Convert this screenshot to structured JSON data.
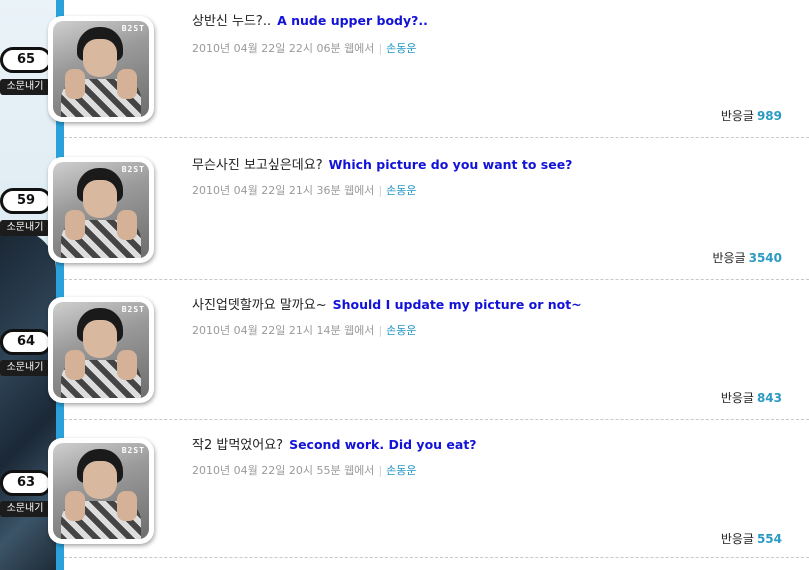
{
  "gossip_label": "소문내기",
  "reply_label": "반응글",
  "posts": [
    {
      "count": "65",
      "title": "상반신 누드?..",
      "translation": "A nude upper body?..",
      "meta": "2010년 04월 22일 22시 06분 웹에서",
      "author": "손동운",
      "replies": "989",
      "avatar_logo": "B2ST"
    },
    {
      "count": "59",
      "title": "무슨사진 보고싶은데요?",
      "translation": "Which picture do you want to see?",
      "meta": "2010년 04월 22일 21시 36분 웹에서",
      "author": "손동운",
      "replies": "3540",
      "avatar_logo": "B2ST"
    },
    {
      "count": "64",
      "title": "사진업뎃할까요 말까요~",
      "translation": "Should I update my picture or not~",
      "meta": "2010년 04월 22일 21시 14분 웹에서",
      "author": "손동운",
      "replies": "843",
      "avatar_logo": "B2ST"
    },
    {
      "count": "63",
      "title": "작2 밥먹었어요?",
      "translation": "Second work. Did you eat?",
      "meta": "2010년 04월 22일 20시 55분 웹에서",
      "author": "손동운",
      "replies": "554",
      "avatar_logo": "B2ST"
    }
  ],
  "colors": {
    "accent_bar": "#2aa1db",
    "translation": "#1212d8",
    "author": "#2196c8",
    "reply_count": "#2b9bc3"
  }
}
